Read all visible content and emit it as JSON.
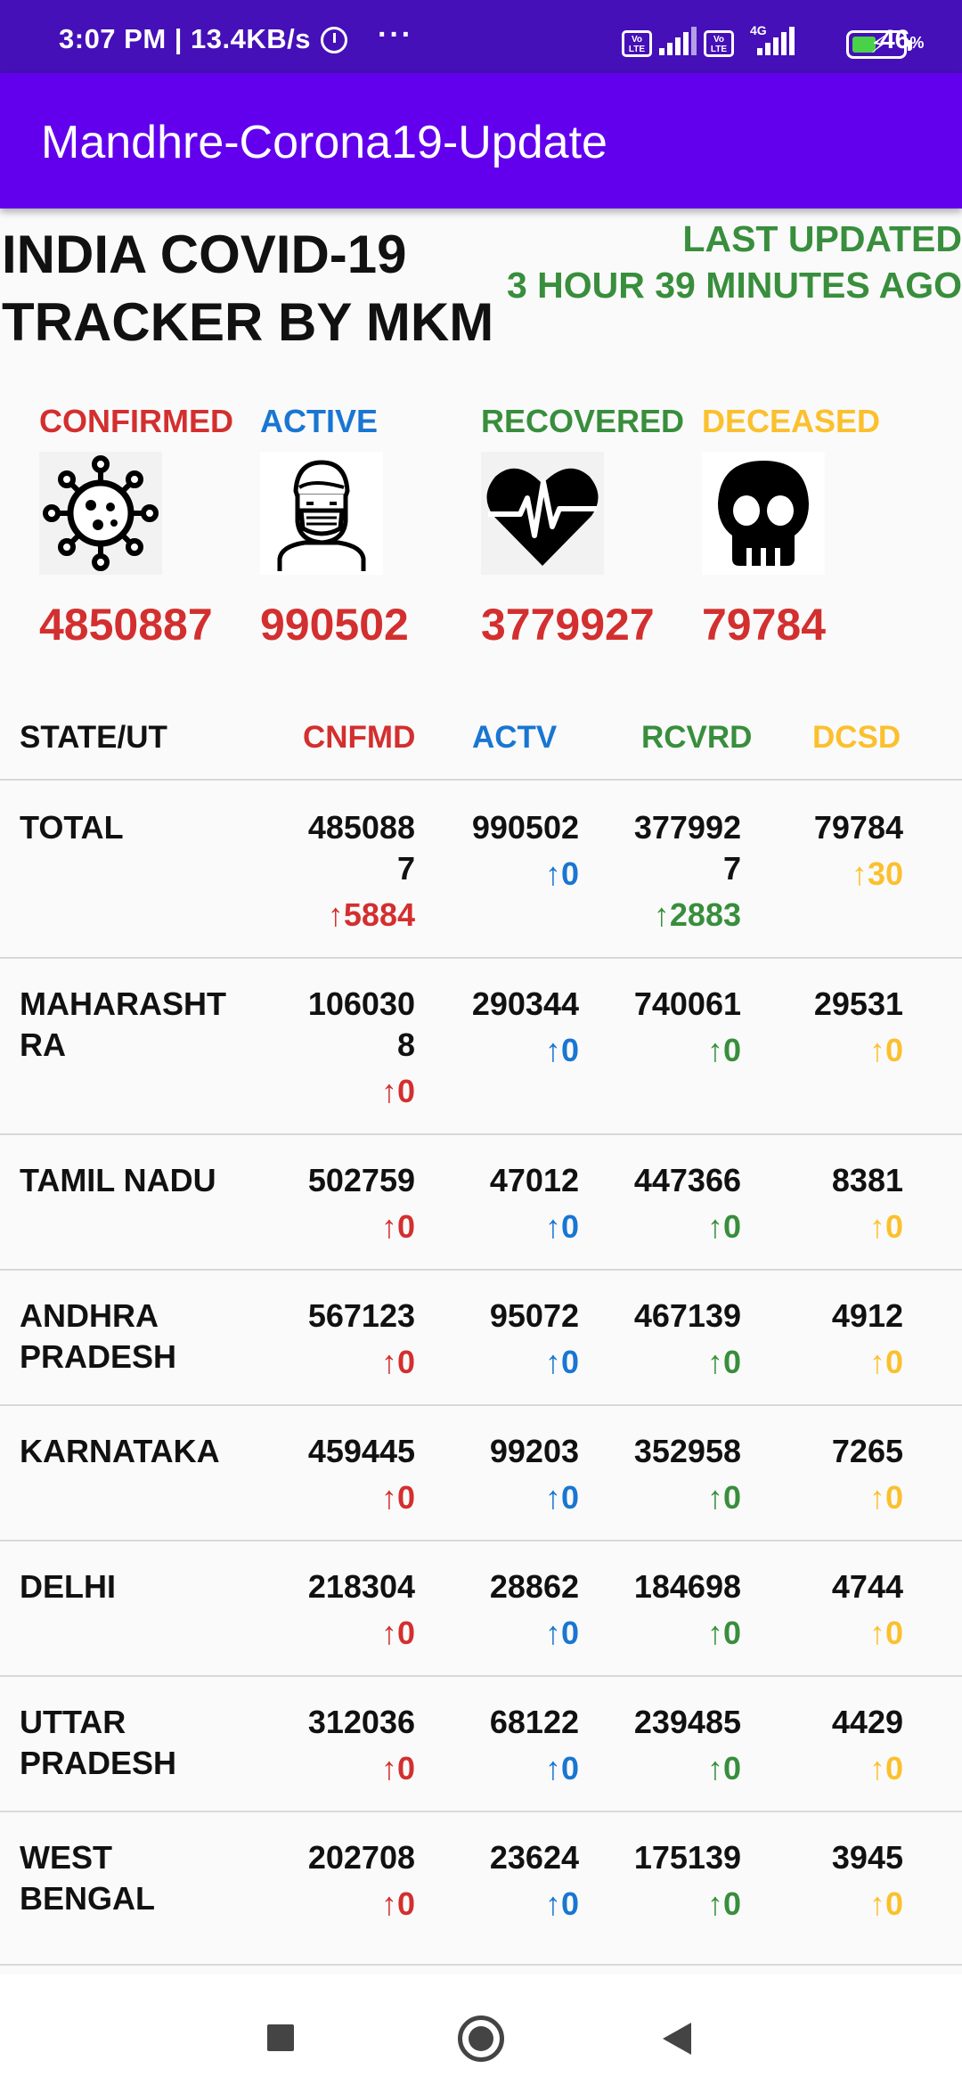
{
  "status_bar": {
    "time_speed": "3:07 PM | 13.4KB/s",
    "more": "···",
    "lte_1": "Vo LTE",
    "lte_2": "Vo LTE",
    "network_type": "4G",
    "battery_text": "46",
    "battery_unit": "%",
    "icons": [
      "alarm-icon",
      "signal-icon",
      "battery-charging-icon"
    ]
  },
  "app_bar": {
    "title": "Mandhre-Corona19-Update"
  },
  "headline": {
    "line1": "INDIA COVID-19",
    "line2": "TRACKER BY MKM"
  },
  "last_updated": {
    "line1": "LAST UPDATED",
    "line2": "3 HOUR 39 MINUTES AGO"
  },
  "summary": [
    {
      "label": "CONFIRMED",
      "value": "4850887",
      "icon": "virus-icon",
      "color": "#d32f2f"
    },
    {
      "label": "ACTIVE",
      "value": "990502",
      "icon": "masked-person-icon",
      "color": "#1976d2"
    },
    {
      "label": "RECOVERED",
      "value": "3779927",
      "icon": "heart-pulse-icon",
      "color": "#388e3c"
    },
    {
      "label": "DECEASED",
      "value": "79784",
      "icon": "skull-icon",
      "color": "#fbc02d"
    }
  ],
  "table": {
    "headers": {
      "state": "STATE/UT",
      "cnfmd": "CNFMD",
      "actv": "ACTV",
      "rcvrd": "RCVRD",
      "dcsd": "DCSD"
    },
    "rows": [
      {
        "state": "TOTAL",
        "cnfmd": "485088\n7",
        "cnfmd_delta": "↑5884",
        "actv": "990502",
        "actv_delta": "↑0",
        "rcvrd": "377992\n7",
        "rcvrd_delta": "↑2883",
        "dcsd": "79784",
        "dcsd_delta": "↑30"
      },
      {
        "state": "MAHARASHT\nRA",
        "cnfmd": "106030\n8",
        "cnfmd_delta": "↑0",
        "actv": "290344",
        "actv_delta": "↑0",
        "rcvrd": "740061",
        "rcvrd_delta": "↑0",
        "dcsd": "29531",
        "dcsd_delta": "↑0"
      },
      {
        "state": "TAMIL NADU",
        "cnfmd": "502759",
        "cnfmd_delta": "↑0",
        "actv": "47012",
        "actv_delta": "↑0",
        "rcvrd": "447366",
        "rcvrd_delta": "↑0",
        "dcsd": "8381",
        "dcsd_delta": "↑0"
      },
      {
        "state": "ANDHRA\nPRADESH",
        "cnfmd": "567123",
        "cnfmd_delta": "↑0",
        "actv": "95072",
        "actv_delta": "↑0",
        "rcvrd": "467139",
        "rcvrd_delta": "↑0",
        "dcsd": "4912",
        "dcsd_delta": "↑0"
      },
      {
        "state": "KARNATAKA",
        "cnfmd": "459445",
        "cnfmd_delta": "↑0",
        "actv": "99203",
        "actv_delta": "↑0",
        "rcvrd": "352958",
        "rcvrd_delta": "↑0",
        "dcsd": "7265",
        "dcsd_delta": "↑0"
      },
      {
        "state": "DELHI",
        "cnfmd": "218304",
        "cnfmd_delta": "↑0",
        "actv": "28862",
        "actv_delta": "↑0",
        "rcvrd": "184698",
        "rcvrd_delta": "↑0",
        "dcsd": "4744",
        "dcsd_delta": "↑0"
      },
      {
        "state": "UTTAR\nPRADESH",
        "cnfmd": "312036",
        "cnfmd_delta": "↑0",
        "actv": "68122",
        "actv_delta": "↑0",
        "rcvrd": "239485",
        "rcvrd_delta": "↑0",
        "dcsd": "4429",
        "dcsd_delta": "↑0"
      },
      {
        "state": "WEST\nBENGAL",
        "cnfmd": "202708",
        "cnfmd_delta": "↑0",
        "actv": "23624",
        "actv_delta": "↑0",
        "rcvrd": "175139",
        "rcvrd_delta": "↑0",
        "dcsd": "3945",
        "dcsd_delta": "↑0"
      }
    ]
  },
  "nav_bar": {
    "icons": [
      "recents-square-icon",
      "home-circle-icon",
      "back-triangle-icon"
    ]
  }
}
